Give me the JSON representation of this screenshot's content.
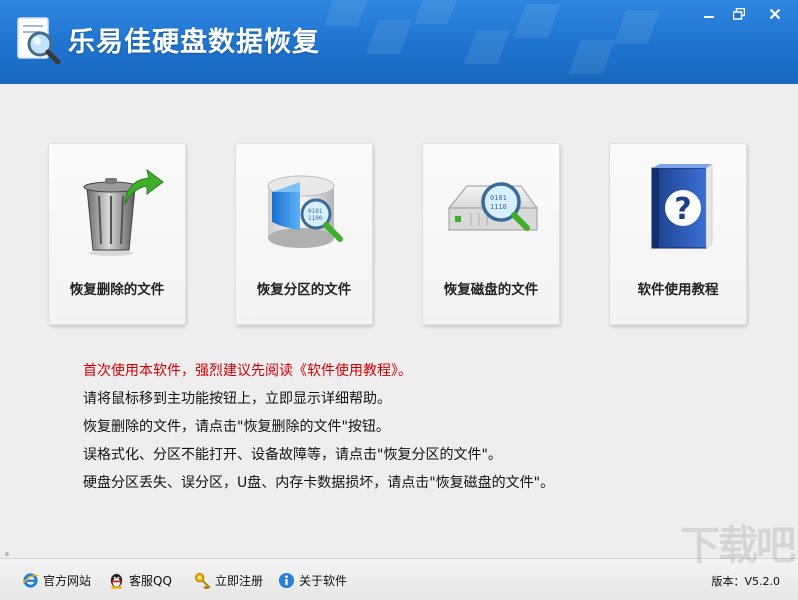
{
  "window": {
    "title": "乐易佳硬盘数据恢复"
  },
  "colors": {
    "titlebar": "#1f73cf",
    "warning_text": "#d40000",
    "card_background": "#f6f6f6"
  },
  "cards": [
    {
      "label": "恢复删除的文件",
      "icon": "recycle-bin-arrow-icon"
    },
    {
      "label": "恢复分区的文件",
      "icon": "partition-disk-magnifier-icon"
    },
    {
      "label": "恢复磁盘的文件",
      "icon": "hard-disk-magnifier-icon"
    },
    {
      "label": "软件使用教程",
      "icon": "help-book-icon"
    }
  ],
  "help": [
    "首次使用本软件，强烈建议先阅读《软件使用教程》。",
    "请将鼠标移到主功能按钮上，立即显示详细帮助。",
    "恢复删除的文件，请点击\"恢复删除的文件\"按钮。",
    "误格式化、分区不能打开、设备故障等，请点击\"恢复分区的文件\"。",
    "硬盘分区丢失、误分区，U盘、内存卡数据损坏，请点击\"恢复磁盘的文件\"。"
  ],
  "footer": {
    "links": [
      {
        "label": "官方网站",
        "icon": "ie-browser-icon"
      },
      {
        "label": "客服QQ",
        "icon": "qq-penguin-icon"
      },
      {
        "label": "立即注册",
        "icon": "key-icon"
      },
      {
        "label": "关于软件",
        "icon": "info-icon"
      }
    ],
    "version": "版本：V5.2.0",
    "watermark": "下载吧"
  }
}
